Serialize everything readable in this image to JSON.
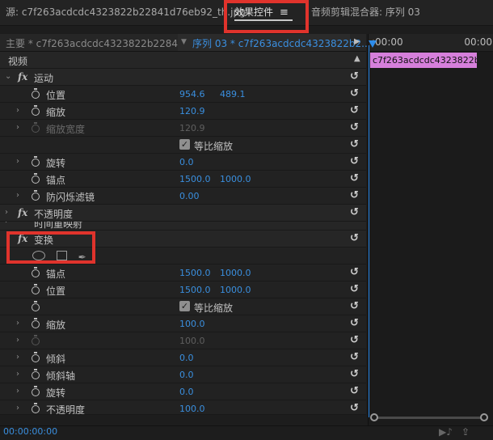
{
  "tabs": {
    "source": "源: c7f263acdcdc4323822b22841d76eb92_th.jpg",
    "effect_controls": "效果控件",
    "effect_menu_icon": "≡",
    "audio_mixer": "音频剪辑混合器: 序列 03"
  },
  "header": {
    "master": "主要 * c7f263acdcdc4323822b22841d7...",
    "sequence": "序列 03 * c7f263acdcdc4323822b2...",
    "play_icon": "▶"
  },
  "timeline": {
    "start_time": ":00:00",
    "end_time": "00:00",
    "clip_name": "c7f263acdcdc4323822b228",
    "scroll_position": 0
  },
  "rows": {
    "video": "视频",
    "motion": "运动",
    "position": {
      "label": "位置",
      "x": "954.6",
      "y": "489.1"
    },
    "scale": {
      "label": "缩放",
      "value": "120.9"
    },
    "scale_width": {
      "label": "缩放宽度",
      "value": "120.9"
    },
    "uniform_scale": "等比缩放",
    "rotation": {
      "label": "旋转",
      "value": "0.0"
    },
    "anchor": {
      "label": "锚点",
      "x": "1500.0",
      "y": "1000.0"
    },
    "anti_flicker": {
      "label": "防闪烁滤镜",
      "value": "0.00"
    },
    "opacity": "不透明度",
    "time_remap": "时间重映射",
    "transform": "变换",
    "t_anchor": {
      "label": "锚点",
      "x": "1500.0",
      "y": "1000.0"
    },
    "t_position": {
      "label": "位置",
      "x": "1500.0",
      "y": "1000.0"
    },
    "t_uniform_scale": "等比缩放",
    "t_scale": {
      "label": "缩放",
      "value": "100.0"
    },
    "t_scale_dim": {
      "value": "100.0"
    },
    "t_skew": {
      "label": "倾斜",
      "value": "0.0"
    },
    "t_skew_axis": {
      "label": "倾斜轴",
      "value": "0.0"
    },
    "t_rotation": {
      "label": "旋转",
      "value": "0.0"
    },
    "t_opacity": {
      "label": "不透明度",
      "value": "100.0"
    }
  },
  "bottom": {
    "timecode": "00:00:00:00"
  },
  "colors": {
    "accent_blue": "#3a8fdf",
    "highlight_red": "#e0332c",
    "clip_pink": "#d67fdb"
  }
}
